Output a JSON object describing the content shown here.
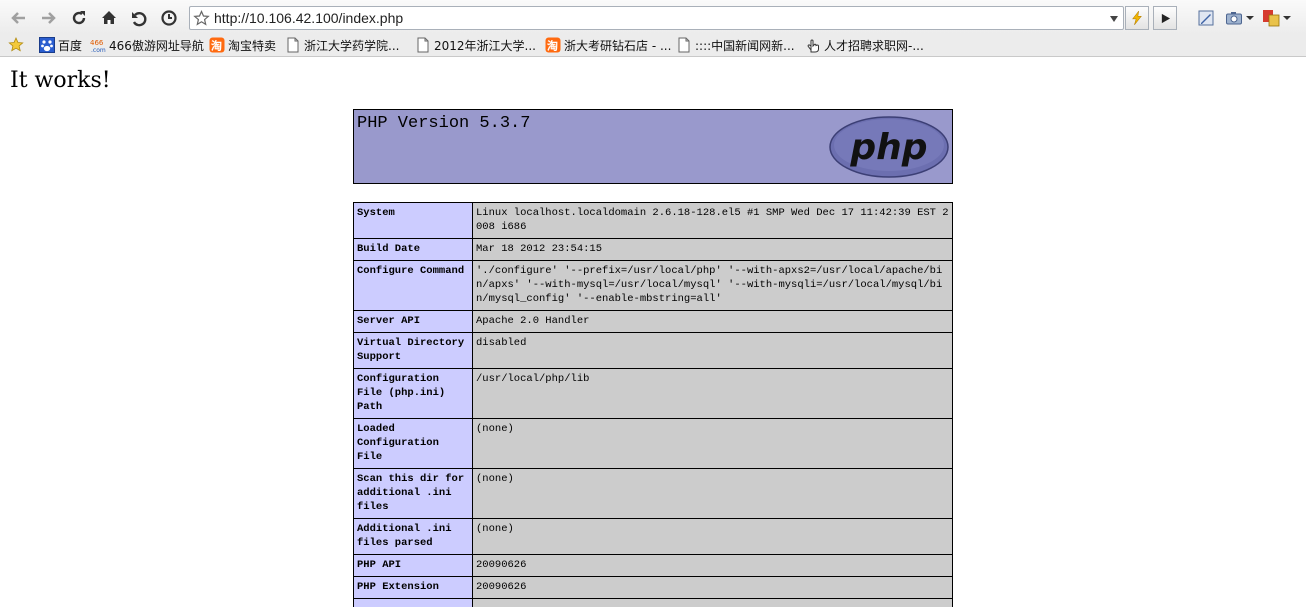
{
  "browser": {
    "url": "http://10.106.42.100/index.php",
    "bookmarks": [
      {
        "label": "百度",
        "icon": "baidu-icon"
      },
      {
        "label": "466傲游网址导航",
        "icon": "466-icon"
      },
      {
        "label": "淘宝特卖",
        "icon": "taobao-icon"
      },
      {
        "label": "浙江大学药学院...",
        "icon": "page-icon"
      },
      {
        "label": "2012年浙江大学...",
        "icon": "page-icon"
      },
      {
        "label": "浙大考研钻石店 - ...",
        "icon": "taobao-icon"
      },
      {
        "label": "::::中国新闻网新...",
        "icon": "page-icon"
      },
      {
        "label": "人才招聘求职网-...",
        "icon": "hand-icon"
      }
    ]
  },
  "page": {
    "heading": "It works!",
    "php_version": "PHP Version 5.3.7",
    "logo_text": "php",
    "rows": [
      {
        "key": "System",
        "value": "Linux localhost.localdomain 2.6.18-128.el5 #1 SMP Wed Dec 17 11:42:39 EST 2008 i686"
      },
      {
        "key": "Build Date",
        "value": "Mar 18 2012 23:54:15"
      },
      {
        "key": "Configure Command",
        "value": "'./configure' '--prefix=/usr/local/php' '--with-apxs2=/usr/local/apache/bin/apxs' '--with-mysql=/usr/local/mysql' '--with-mysqli=/usr/local/mysql/bin/mysql_config' '--enable-mbstring=all'"
      },
      {
        "key": "Server API",
        "value": "Apache 2.0 Handler"
      },
      {
        "key": "Virtual Directory Support",
        "value": "disabled"
      },
      {
        "key": "Configuration File (php.ini) Path",
        "value": "/usr/local/php/lib"
      },
      {
        "key": "Loaded Configuration File",
        "value": "(none)"
      },
      {
        "key": "Scan this dir for additional .ini files",
        "value": "(none)"
      },
      {
        "key": "Additional .ini files parsed",
        "value": "(none)"
      },
      {
        "key": "PHP API",
        "value": "20090626"
      },
      {
        "key": "PHP Extension",
        "value": "20090626"
      },
      {
        "key": "",
        "value": ""
      }
    ]
  },
  "colors": {
    "header_bg": "#9999cc",
    "key_bg": "#ccccff",
    "value_bg": "#cccccc"
  }
}
